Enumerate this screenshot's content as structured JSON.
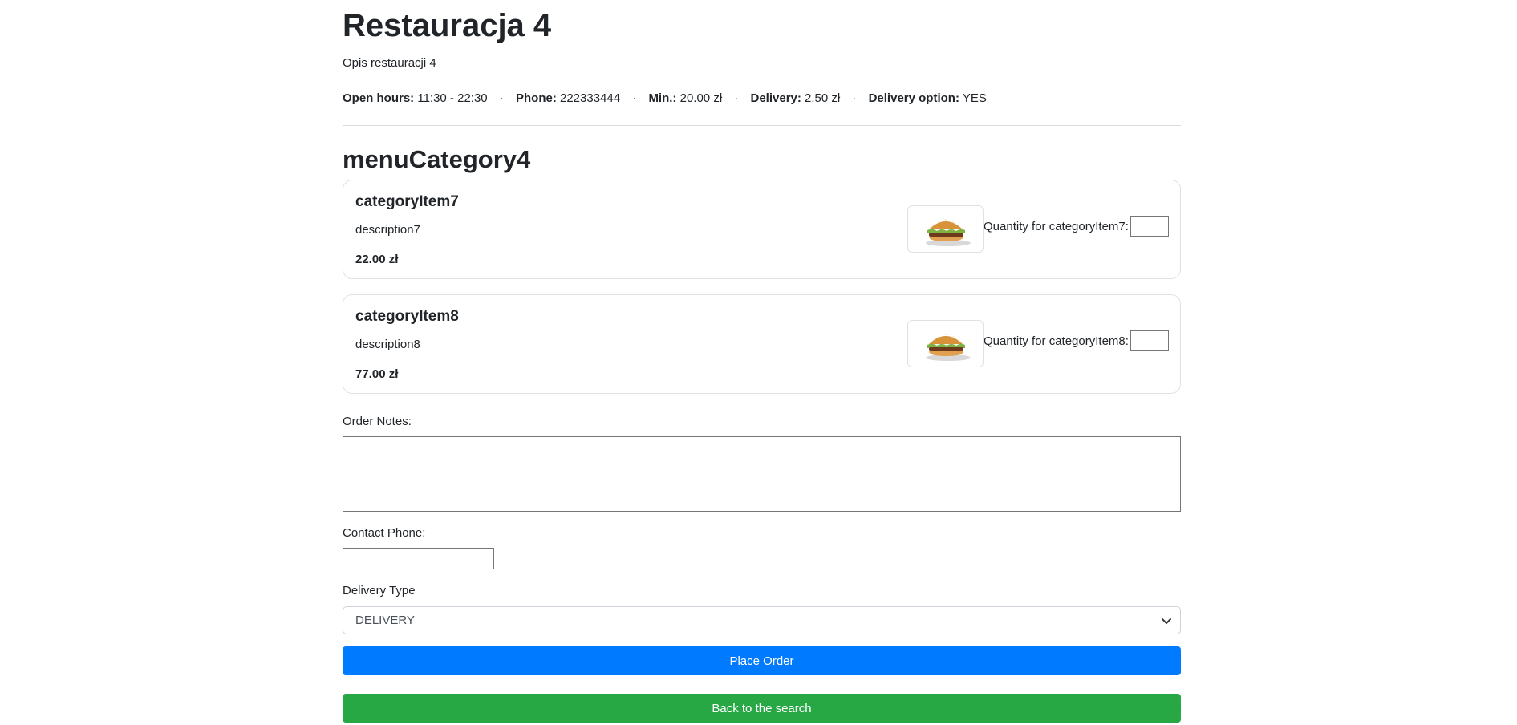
{
  "restaurant": {
    "name": "Restauracja 4",
    "description": "Opis restauracji 4",
    "info": {
      "open_hours_label": "Open hours:",
      "open_hours": "11:30 - 22:30",
      "phone_label": "Phone:",
      "phone": "222333444",
      "min_label": "Min.:",
      "min": "20.00 zł",
      "delivery_label": "Delivery:",
      "delivery": "2.50 zł",
      "delivery_option_label": "Delivery option:",
      "delivery_option": "YES",
      "separator": "·"
    }
  },
  "menu": {
    "category_title": "menuCategory4",
    "items": [
      {
        "name": "categoryItem7",
        "description": "description7",
        "price": "22.00 zł",
        "image_icon": "burger-image",
        "quantity_label": "Quantity for categoryItem7:",
        "quantity_value": ""
      },
      {
        "name": "categoryItem8",
        "description": "description8",
        "price": "77.00 zł",
        "image_icon": "burger-image",
        "quantity_label": "Quantity for categoryItem8:",
        "quantity_value": ""
      }
    ]
  },
  "form": {
    "notes_label": "Order Notes:",
    "notes_value": "",
    "phone_label": "Contact Phone:",
    "phone_value": "",
    "delivery_type_label": "Delivery Type",
    "delivery_type_value": "DELIVERY",
    "place_order_label": "Place Order",
    "back_label": "Back to the search"
  },
  "colors": {
    "primary": "#007bff",
    "success": "#28a745",
    "text": "#212529",
    "border": "#dee2e6"
  }
}
